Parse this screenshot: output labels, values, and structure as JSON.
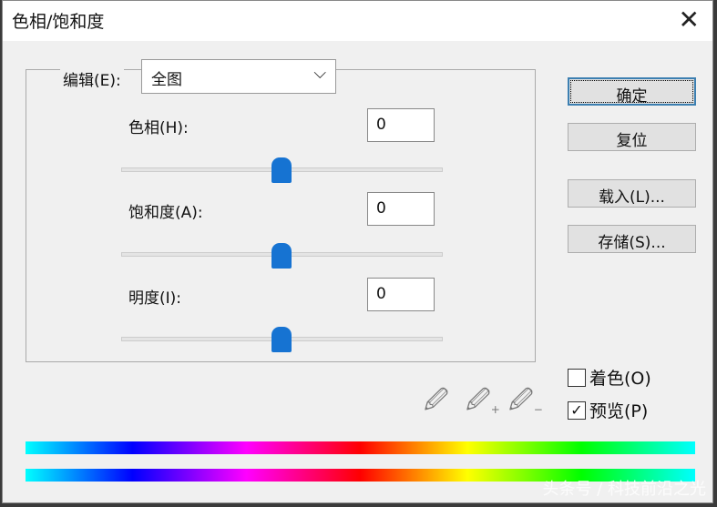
{
  "title": "色相/饱和度",
  "close_label": "✕",
  "edit": {
    "label": "编辑(E):",
    "value": "全图"
  },
  "hue": {
    "label": "色相(H):",
    "value": "0"
  },
  "saturation": {
    "label": "饱和度(A):",
    "value": "0"
  },
  "lightness": {
    "label": "明度(I):",
    "value": "0"
  },
  "buttons": {
    "ok": "确定",
    "reset": "复位",
    "load": "载入(L)...",
    "save": "存储(S)..."
  },
  "colorize": {
    "label": "着色(O)",
    "checked": false
  },
  "preview": {
    "label": "预览(P)",
    "checked": true,
    "mark": "✓"
  },
  "watermark": "头条号 / 科技前沿之光"
}
